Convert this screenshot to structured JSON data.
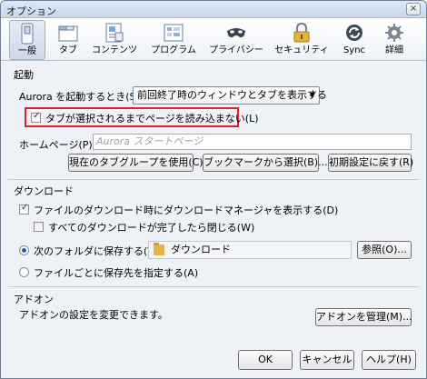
{
  "window": {
    "title": "オプション",
    "close": "×"
  },
  "toolbar": [
    {
      "label": "一般",
      "icon": "general-switch-icon"
    },
    {
      "label": "タブ",
      "icon": "tabs-icon"
    },
    {
      "label": "コンテンツ",
      "icon": "content-icon"
    },
    {
      "label": "プログラム",
      "icon": "applications-icon"
    },
    {
      "label": "プライバシー",
      "icon": "privacy-mask-icon"
    },
    {
      "label": "セキュリティ",
      "icon": "security-lock-icon"
    },
    {
      "label": "Sync",
      "icon": "sync-icon"
    },
    {
      "label": "詳細",
      "icon": "advanced-gear-icon"
    }
  ],
  "startup": {
    "group": "起動",
    "when_label": "Aurora を起動するとき(S):",
    "when_value": "前回終了時のウィンドウとタブを表示する",
    "dont_load_tabs": "タブが選択されるまでページを読み込まない(L)",
    "homepage_label": "ホームページ(P):",
    "homepage_placeholder": "Aurora スタートページ",
    "use_current": "現在のタブグループを使用(C)",
    "use_bookmark": "ブックマークから選択(B)...",
    "restore_default": "初期設定に戻す(R)"
  },
  "downloads": {
    "group": "ダウンロード",
    "show_manager": "ファイルのダウンロード時にダウンロードマネージャを表示する(D)",
    "close_when_done": "すべてのダウンロードが完了したら閉じる(W)",
    "save_to": "次のフォルダに保存する(V)",
    "folder": "ダウンロード",
    "browse": "参照(O)...",
    "always_ask": "ファイルごとに保存先を指定する(A)"
  },
  "addons": {
    "group": "アドオン",
    "desc": "アドオンの設定を変更できます。",
    "manage": "アドオンを管理(M)..."
  },
  "footer": {
    "ok": "OK",
    "cancel": "キャンセル",
    "help": "ヘルプ(H)"
  }
}
